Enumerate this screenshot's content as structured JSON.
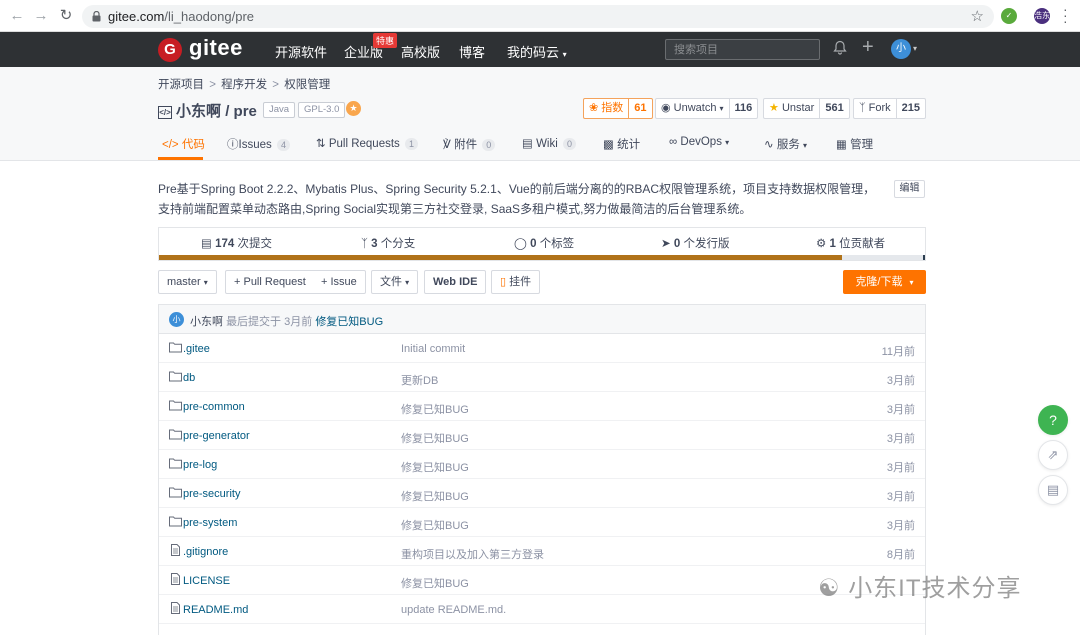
{
  "browser": {
    "url_host": "gitee.com",
    "url_path": "/li_haodong/pre",
    "ext2_label": "浩东"
  },
  "header": {
    "logo_letter": "G",
    "logo": "gitee",
    "nav": [
      "开源软件",
      "企业版",
      "高校版",
      "博客",
      "我的码云"
    ],
    "promo_badge": "特惠",
    "search_placeholder": "搜索项目",
    "avatar": "小"
  },
  "breadcrumb": [
    "开源项目",
    "程序开发",
    "权限管理"
  ],
  "repo": {
    "owner": "小东啊",
    "separator": "/",
    "name": "pre",
    "tags": [
      "Java",
      "GPL-3.0"
    ]
  },
  "stats_buttons": {
    "index": {
      "label": "指数",
      "count": "61"
    },
    "watch": {
      "label": "Unwatch",
      "count": "116"
    },
    "star": {
      "label": "Unstar",
      "count": "561"
    },
    "fork": {
      "label": "Fork",
      "count": "215"
    }
  },
  "tabs": [
    {
      "label": "代码",
      "badge": ""
    },
    {
      "label": "Issues",
      "badge": "4"
    },
    {
      "label": "Pull Requests",
      "badge": "1"
    },
    {
      "label": "附件",
      "badge": "0"
    },
    {
      "label": "Wiki",
      "badge": "0"
    },
    {
      "label": "统计",
      "badge": ""
    },
    {
      "label": "DevOps",
      "badge": ""
    },
    {
      "label": "服务",
      "badge": ""
    },
    {
      "label": "管理",
      "badge": ""
    }
  ],
  "description": "Pre基于Spring Boot 2.2.2、Mybatis Plus、Spring Security 5.2.1、Vue的前后端分离的的RBAC权限管理系统，项目支持数据权限管理，支持前端配置菜单动态路由,Spring Social实现第三方社交登录, SaaS多租户模式,努力做最简洁的后台管理系统。",
  "edit_label": "编辑",
  "repo_stats": {
    "commits": {
      "count": "174",
      "label": "次提交"
    },
    "branches": {
      "count": "3",
      "label": "个分支"
    },
    "tags": {
      "count": "0",
      "label": "个标签"
    },
    "releases": {
      "count": "0",
      "label": "个发行版"
    },
    "contributors": {
      "count": "1",
      "label": "位贡献者"
    }
  },
  "language_bar": [
    {
      "color": "#b07219",
      "fraction": 0.892
    },
    {
      "color": "#e5e8ec",
      "fraction": 0.106
    },
    {
      "color": "#2c3e50",
      "fraction": 0.002
    }
  ],
  "actions": {
    "branch": "master",
    "pull_request": "+ Pull Request",
    "issue": "+ Issue",
    "files": "文件",
    "web_ide": "Web IDE",
    "widget": "挂件",
    "clone": "克隆/下载"
  },
  "last_commit": {
    "avatar": "小",
    "author": "小东啊",
    "text": "最后提交于 3月前",
    "message": "修复已知BUG"
  },
  "files": [
    {
      "type": "folder",
      "name": ".gitee",
      "message": "Initial commit",
      "time": "11月前"
    },
    {
      "type": "folder",
      "name": "db",
      "message": "更新DB",
      "time": "3月前"
    },
    {
      "type": "folder",
      "name": "pre-common",
      "message": "修复已知BUG",
      "time": "3月前"
    },
    {
      "type": "folder",
      "name": "pre-generator",
      "message": "修复已知BUG",
      "time": "3月前"
    },
    {
      "type": "folder",
      "name": "pre-log",
      "message": "修复已知BUG",
      "time": "3月前"
    },
    {
      "type": "folder",
      "name": "pre-security",
      "message": "修复已知BUG",
      "time": "3月前"
    },
    {
      "type": "folder",
      "name": "pre-system",
      "message": "修复已知BUG",
      "time": "3月前"
    },
    {
      "type": "file",
      "name": ".gitignore",
      "message": "重构项目以及加入第三方登录",
      "time": "8月前"
    },
    {
      "type": "file",
      "name": "LICENSE",
      "message": "修复已知BUG",
      "time": ""
    },
    {
      "type": "file",
      "name": "README.md",
      "message": "update README.md.",
      "time": ""
    }
  ],
  "floating": {
    "help": "?"
  },
  "watermark": "小东IT技术分享",
  "colors": {
    "accent": "#fe7300",
    "header": "#2e3134",
    "link": "#005980",
    "brand_red": "#c71d23"
  }
}
